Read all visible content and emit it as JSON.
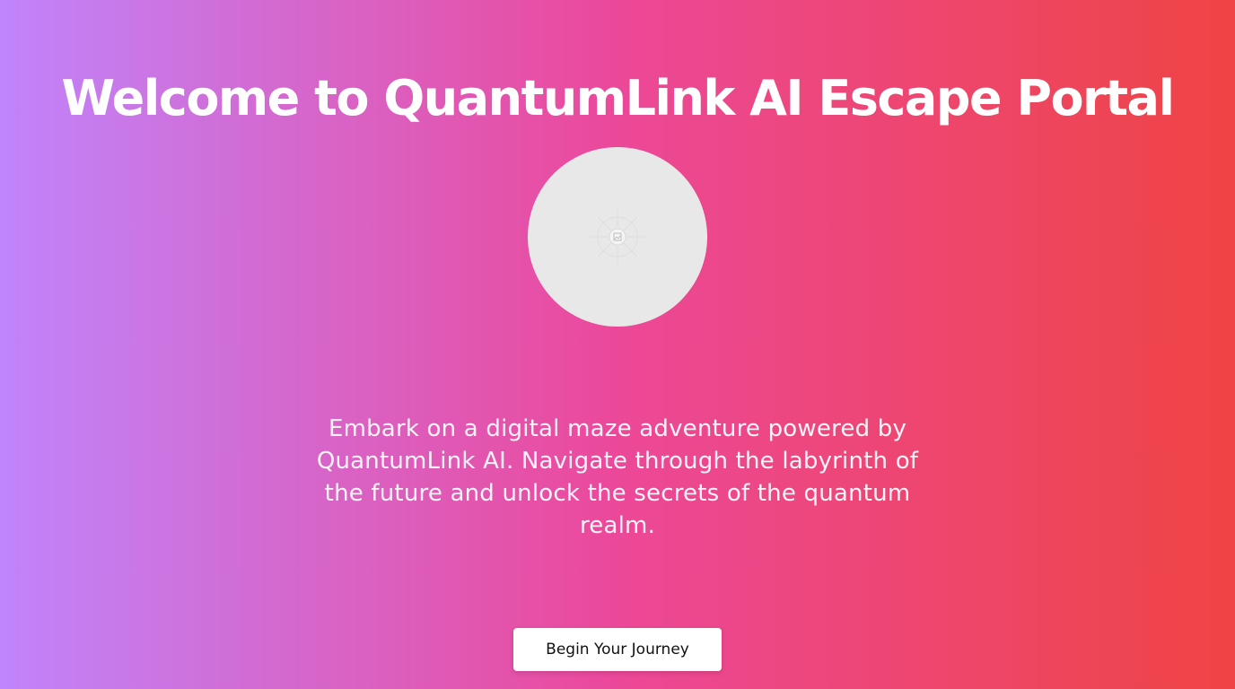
{
  "page": {
    "title": "Welcome to QuantumLink AI Escape Portal",
    "description": "Embark on a digital maze adventure powered by QuantumLink AI. Navigate through the labyrinth of the future and unlock the secrets of the quantum realm.",
    "cta_label": "Begin Your Journey"
  },
  "portal": {
    "image_icon": "broken-image-icon"
  },
  "colors": {
    "gradient_start": "#c084fc",
    "gradient_mid": "#ec4899",
    "gradient_end": "#ef4444",
    "portal_fill": "#e8e8e8",
    "button_bg": "#ffffff",
    "button_text": "#111111"
  }
}
